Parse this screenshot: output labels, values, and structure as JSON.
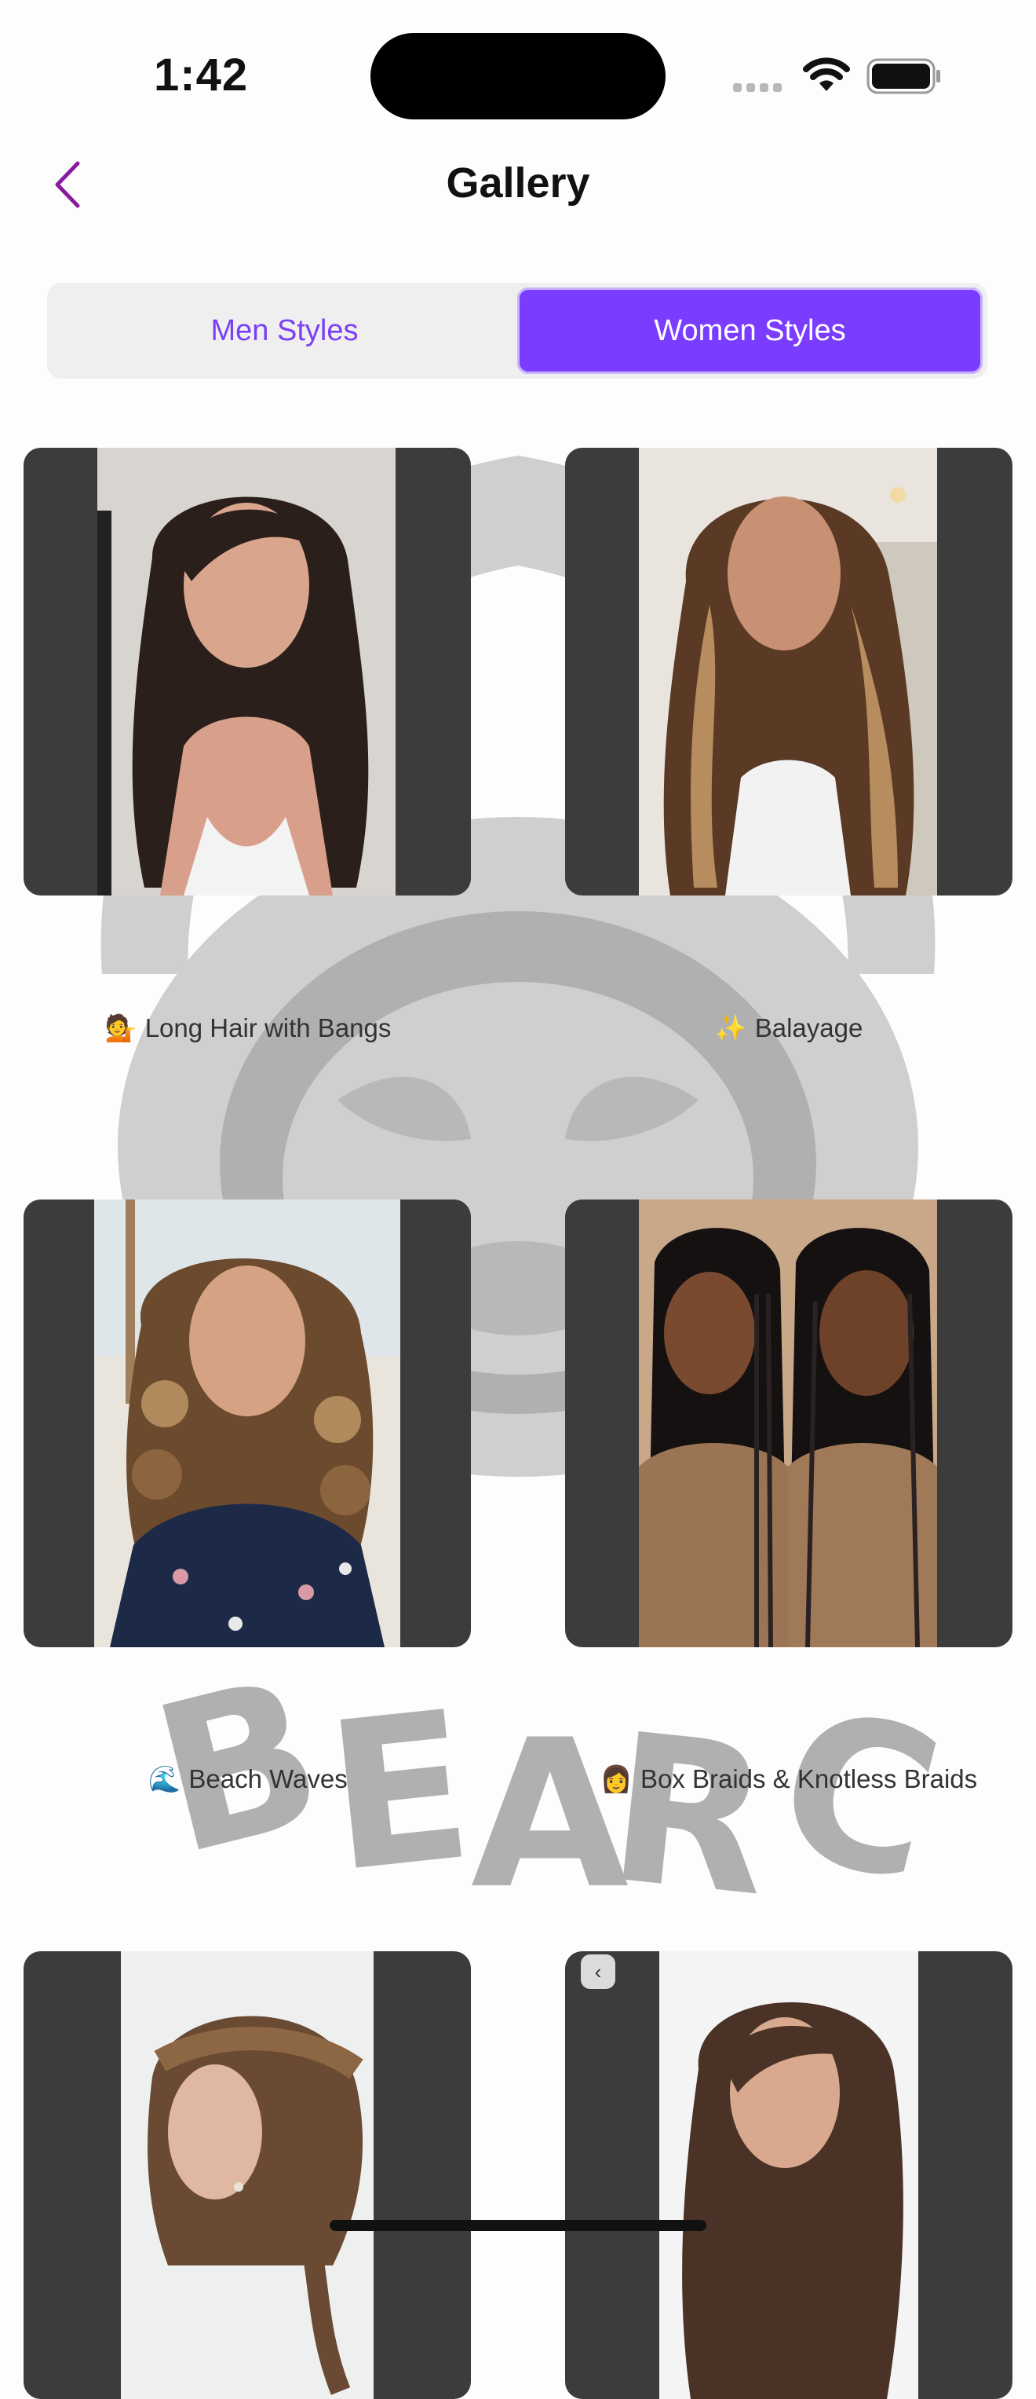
{
  "status": {
    "time": "1:42"
  },
  "header": {
    "title": "Gallery",
    "back_label": "Back"
  },
  "segments": [
    {
      "label": "Men Styles",
      "selected": false
    },
    {
      "label": "Women Styles",
      "selected": true
    }
  ],
  "gallery": [
    {
      "emoji": "💁",
      "name": "Long Hair with Bangs"
    },
    {
      "emoji": "✨",
      "name": "Balayage"
    },
    {
      "emoji": "🌊",
      "name": "Beach Waves"
    },
    {
      "emoji": "👩",
      "name": "Box Braids & Knotless Braids"
    }
  ],
  "watermark_text": "BEAR CUTS",
  "colors": {
    "accent": "#7a3cff",
    "card_bg": "#3c3c3c",
    "watermark": "#c9c9c9"
  }
}
